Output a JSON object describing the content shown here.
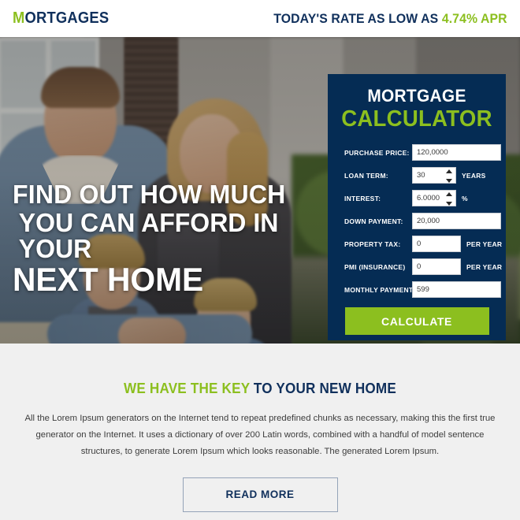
{
  "colors": {
    "green": "#8cbf1f",
    "navy": "#10305c",
    "panel_navy": "#052c54",
    "page_bg": "#f0f0f0"
  },
  "header": {
    "logo_lead": "M",
    "logo_rest": "ORTGAGES",
    "rate_prefix": "TODAY'S RATE AS LOW AS ",
    "rate_value": "4.74% APR"
  },
  "hero": {
    "headline_line1": "FIND OUT HOW MUCH",
    "headline_line2": "YOU CAN AFFORD IN YOUR",
    "headline_line3": "NEXT HOME"
  },
  "calculator": {
    "title_line1": "MORTGAGE",
    "title_line2": "CALCULATOR",
    "fields": [
      {
        "label": "PURCHASE PRICE:",
        "value": "120,0000",
        "unit": "",
        "spinner": false
      },
      {
        "label": "LOAN TERM:",
        "value": "30",
        "unit": "YEARS",
        "spinner": true
      },
      {
        "label": "INTEREST:",
        "value": "6.0000",
        "unit": "%",
        "spinner": true
      },
      {
        "label": "DOWN PAYMENT:",
        "value": "20,000",
        "unit": "",
        "spinner": false
      },
      {
        "label": "PROPERTY TAX:",
        "value": "0",
        "unit": "PER YEAR",
        "spinner": false
      },
      {
        "label": "PMI (INSURANCE)",
        "value": "0",
        "unit": "PER YEAR",
        "spinner": false
      },
      {
        "label": "MONTHLY PAYMENT:",
        "value": "599",
        "unit": "",
        "spinner": false
      }
    ],
    "submit_label": "CALCULATE"
  },
  "content": {
    "heading_green": "WE HAVE THE KEY",
    "heading_navy": " TO YOUR NEW HOME",
    "paragraph": "All the Lorem Ipsum generators on the Internet tend to repeat predefined chunks as necessary, making this the first true generator on the Internet. It uses a dictionary of over 200 Latin words, combined with a handful of model sentence structures, to generate Lorem Ipsum which looks reasonable. The generated Lorem Ipsum.",
    "read_more_label": "READ MORE"
  }
}
